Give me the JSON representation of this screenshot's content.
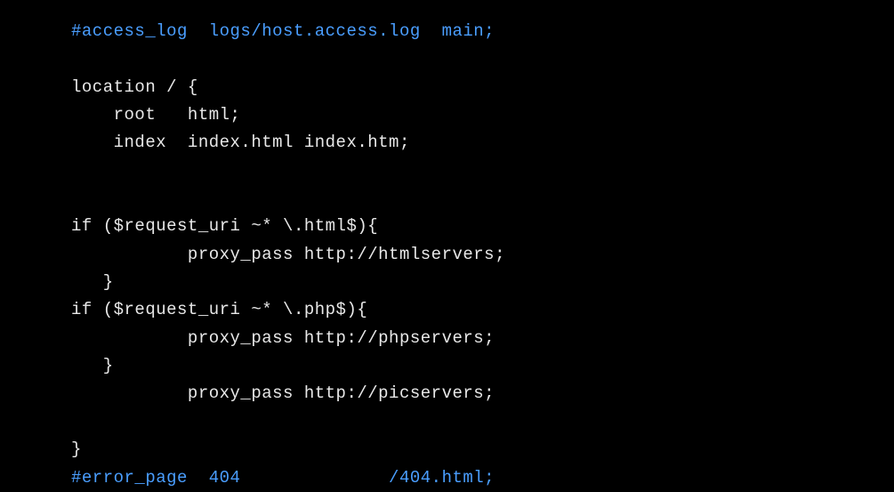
{
  "code": {
    "line1": "#access_log  logs/host.access.log  main;",
    "line2": "",
    "line3": "location / {",
    "line4": "    root   html;",
    "line5": "    index  index.html index.htm;",
    "line6": "",
    "line7": "",
    "line8": "if ($request_uri ~* \\.html$){",
    "line9": "           proxy_pass http://htmlservers;",
    "line10": "   }",
    "line11": "if ($request_uri ~* \\.php$){",
    "line12": "           proxy_pass http://phpservers;",
    "line13": "   }",
    "line14": "           proxy_pass http://picservers;",
    "line15": "",
    "line16": "}",
    "line17": "#error_page  404              /404.html;"
  }
}
